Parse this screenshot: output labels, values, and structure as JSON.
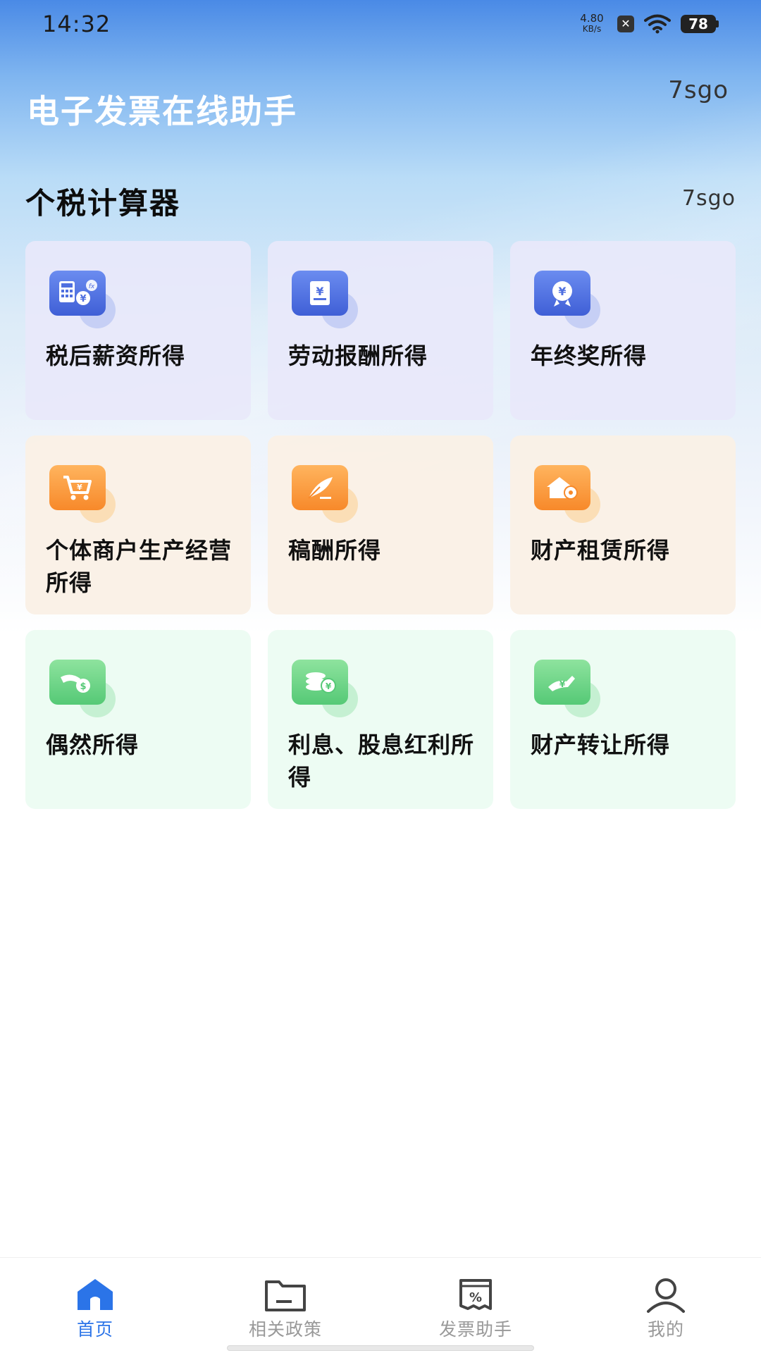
{
  "status_bar": {
    "time": "14:32",
    "net_speed_value": "4.80",
    "net_speed_unit": "KB/s",
    "battery": "78",
    "icons": [
      "close-box-icon",
      "wifi-icon",
      "battery-icon"
    ]
  },
  "header": {
    "app_title": "电子发票在线助手",
    "watermark": "7sgo"
  },
  "section": {
    "title": "个税计算器",
    "watermark": "7sgo"
  },
  "calculators": [
    {
      "label": "税后薪资所得",
      "icon": "salary-calculator-icon",
      "theme": "purple"
    },
    {
      "label": "劳动报酬所得",
      "icon": "labor-remuneration-icon",
      "theme": "purple"
    },
    {
      "label": "年终奖所得",
      "icon": "year-end-bonus-icon",
      "theme": "purple"
    },
    {
      "label": "个体商户生产经营所得",
      "icon": "shopping-cart-icon",
      "theme": "orange"
    },
    {
      "label": "稿酬所得",
      "icon": "quill-icon",
      "theme": "orange"
    },
    {
      "label": "财产租赁所得",
      "icon": "house-key-icon",
      "theme": "orange"
    },
    {
      "label": "偶然所得",
      "icon": "cash-hand-icon",
      "theme": "green"
    },
    {
      "label": "利息、股息红利所得",
      "icon": "coins-icon",
      "theme": "green"
    },
    {
      "label": "财产转让所得",
      "icon": "transfer-hand-icon",
      "theme": "green"
    }
  ],
  "tab_bar": {
    "tabs": [
      {
        "label": "首页",
        "icon": "home-icon",
        "active": true
      },
      {
        "label": "相关政策",
        "icon": "folder-icon",
        "active": false
      },
      {
        "label": "发票助手",
        "icon": "invoice-percent-icon",
        "active": false
      },
      {
        "label": "我的",
        "icon": "user-icon",
        "active": false
      }
    ]
  },
  "colors": {
    "accent": "#2b74e8",
    "purple_card": "#e8e8fa",
    "orange_card": "#faf0e6",
    "green_card": "#edfcf3"
  }
}
